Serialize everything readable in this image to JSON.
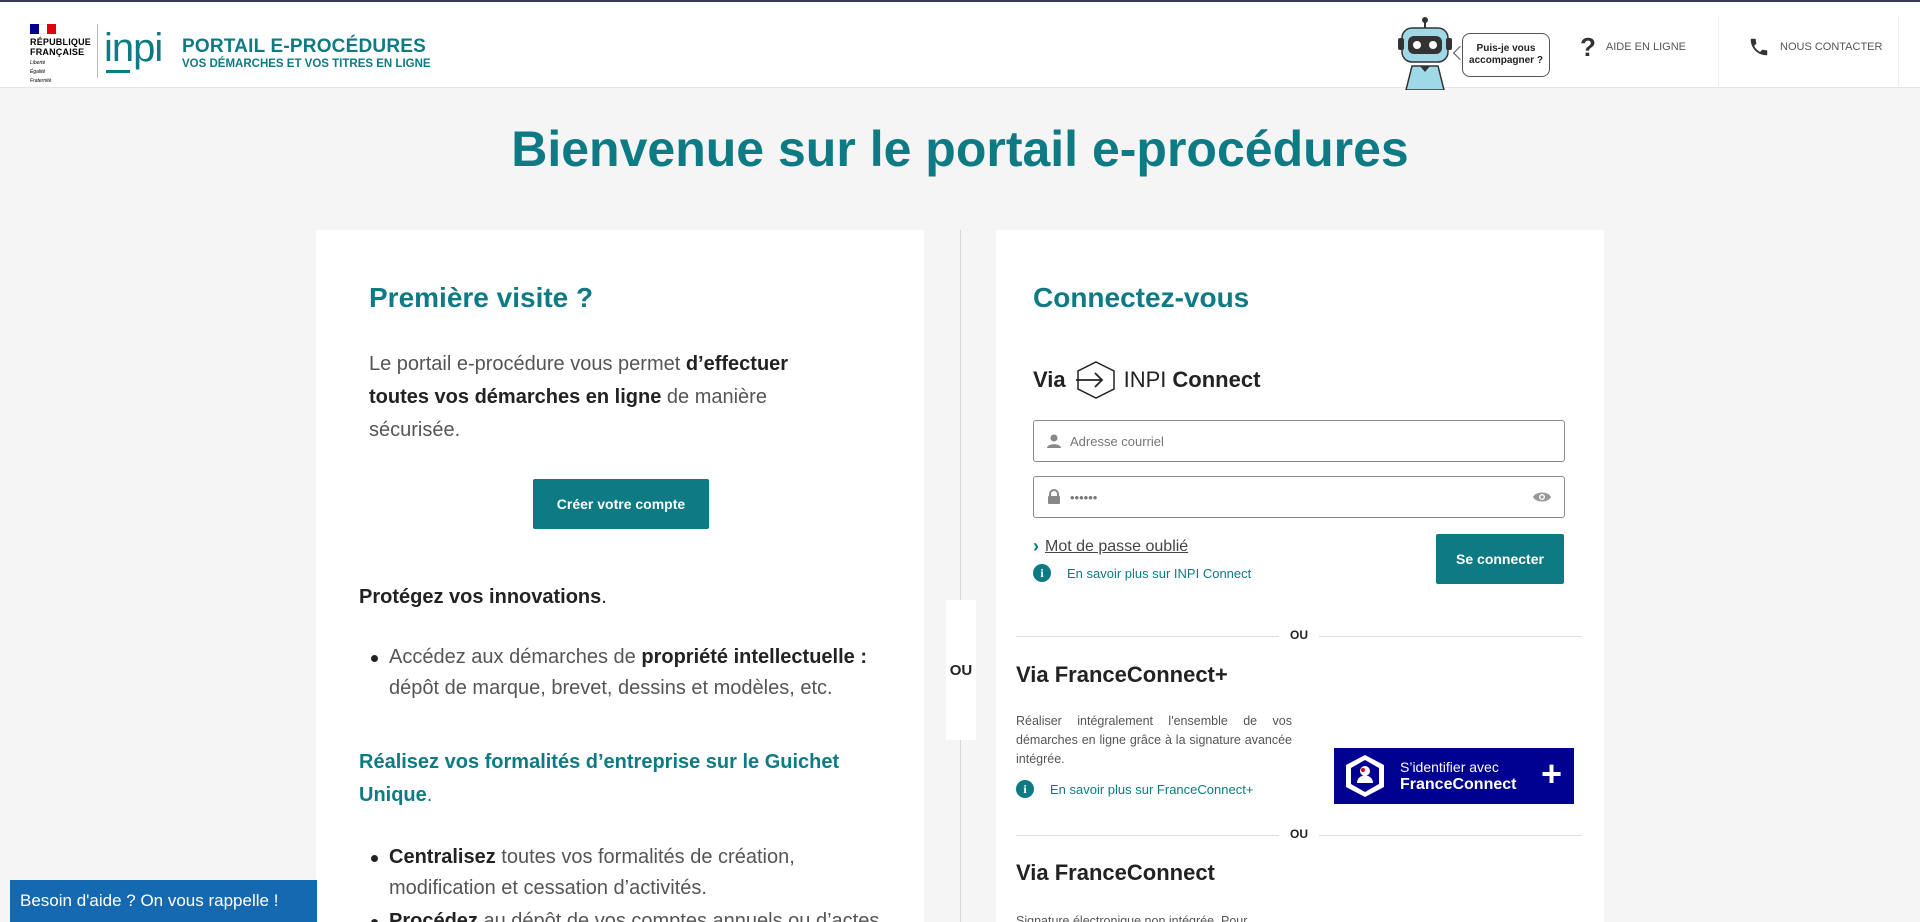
{
  "header": {
    "republique_lines": [
      "RÉPUBLIQUE",
      "FRANÇAISE"
    ],
    "motto_lines": [
      "Liberté",
      "Égalité",
      "Fraternité"
    ],
    "inpi_logo": "inpi",
    "portal_title": "PORTAIL E-PROCÉDURES",
    "portal_subtitle": "VOS DÉMARCHES ET VOS TITRES EN LIGNE",
    "chatbot_bubble": [
      "Puis-je vous",
      "accompagner ?"
    ],
    "help_link": "AIDE EN LIGNE",
    "contact_link": "NOUS CONTACTER",
    "flag_colors": [
      "#000091",
      "#ffffff",
      "#e1000f"
    ]
  },
  "main": {
    "title": "Bienvenue sur le portail e-procédures"
  },
  "left_card": {
    "title": "Première visite ?",
    "intro_part1": "Le portail e-procédure vous permet ",
    "intro_bold": "d’effectuer toutes vos démarches en ligne",
    "intro_part2": " de manière sécurisée.",
    "create_button": "Créer votre compte",
    "section1_title": "Protégez vos innovations",
    "section1_dot": ".",
    "section1_item_part1": "Accédez aux démarches de ",
    "section1_item_bold": "propriété intellectuelle :",
    "section1_item_part2": " dépôt de marque, brevet, dessins et modèles, etc.",
    "section2_title": "Réalisez vos formalités d’entreprise sur le Guichet Unique",
    "section2_dot": ".",
    "section2_item1_bold": "Centralisez",
    "section2_item1_text": " toutes vos formalités de création, modification et cessation d’activités.",
    "section2_item2_bold": "Procédez",
    "section2_item2_text": " au dépôt de vos comptes annuels ou d’actes"
  },
  "divider_label": "OU",
  "right_card": {
    "title": "Connectez-vous",
    "via_label": "Via",
    "inpi_connect_light": "INPI",
    "inpi_connect_bold": "Connect",
    "email_placeholder": "Adresse courriel",
    "password_value": "••••••",
    "forgot_password": "Mot de passe oublié",
    "learn_inpi_connect": "En savoir plus sur INPI Connect",
    "login_button": "Se connecter",
    "or_label": "OU",
    "fc_plus_title": "Via FranceConnect+",
    "fc_plus_desc": "Réaliser intégralement l'ensemble de vos démarches en ligne grâce à la signature avancée intégrée.",
    "learn_fc_plus": "En savoir plus sur FranceConnect+",
    "fc_button_line1": "S’identifier avec",
    "fc_button_line2": "FranceConnect",
    "fc_button_plus": "+",
    "fc_title": "Via FranceConnect",
    "fc_desc": "Signature électronique non intégrée. Pour finaliser"
  },
  "callback_button": "Besoin d'aide ? On vous rappelle !",
  "colors": {
    "brand_teal": "#0d7a84",
    "franceconnect_blue": "#000091",
    "callback_blue": "#1469b0"
  }
}
